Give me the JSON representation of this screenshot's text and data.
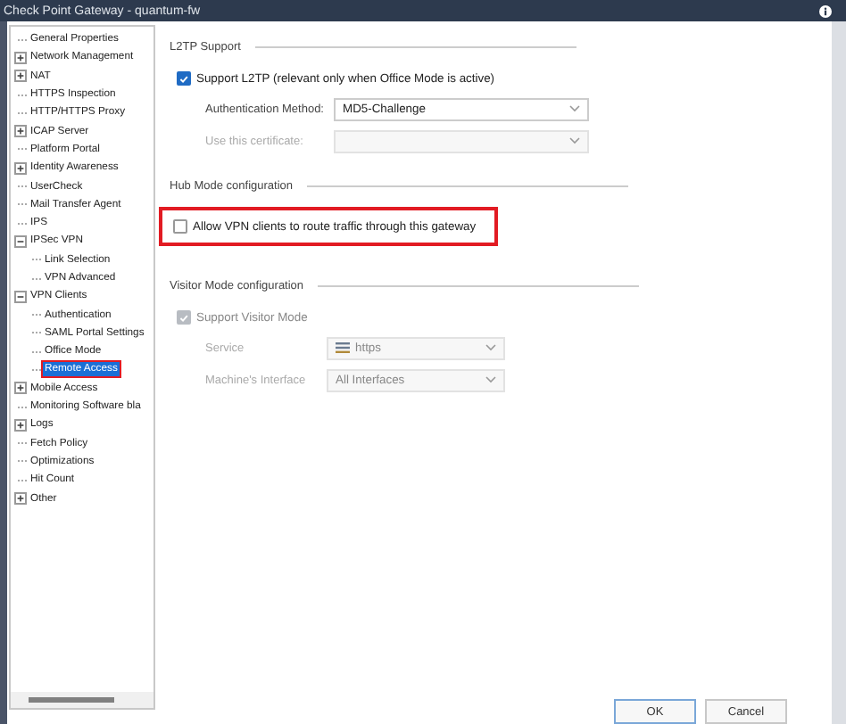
{
  "window": {
    "title": "Check Point Gateway - quantum-fw"
  },
  "tree": [
    {
      "label": "General Properties",
      "selected": false,
      "highlighted": false
    },
    {
      "label": "Network Management",
      "expanded": false,
      "selected": false,
      "highlighted": false
    },
    {
      "label": "NAT",
      "expanded": false,
      "selected": false,
      "highlighted": false
    },
    {
      "label": "HTTPS Inspection",
      "selected": false,
      "highlighted": false
    },
    {
      "label": "HTTP/HTTPS Proxy",
      "selected": false,
      "highlighted": false
    },
    {
      "label": "ICAP Server",
      "expanded": false,
      "selected": false,
      "highlighted": false
    },
    {
      "label": "Platform Portal",
      "selected": false,
      "highlighted": false
    },
    {
      "label": "Identity Awareness",
      "expanded": false,
      "selected": false,
      "highlighted": false
    },
    {
      "label": "UserCheck",
      "selected": false,
      "highlighted": false
    },
    {
      "label": "Mail Transfer Agent",
      "selected": false,
      "highlighted": false
    },
    {
      "label": "IPS",
      "selected": false,
      "highlighted": false
    },
    {
      "label": "IPSec VPN",
      "expanded": true,
      "selected": false,
      "highlighted": false,
      "children": [
        {
          "label": "Link Selection",
          "selected": false,
          "highlighted": false
        },
        {
          "label": "VPN Advanced",
          "selected": false,
          "highlighted": false
        }
      ]
    },
    {
      "label": "VPN Clients",
      "expanded": true,
      "selected": false,
      "highlighted": false,
      "children": [
        {
          "label": "Authentication",
          "selected": false,
          "highlighted": false
        },
        {
          "label": "SAML Portal Settings",
          "selected": false,
          "highlighted": false
        },
        {
          "label": "Office Mode",
          "selected": false,
          "highlighted": false
        },
        {
          "label": "Remote Access",
          "selected": true,
          "highlighted": true
        }
      ]
    },
    {
      "label": "Mobile Access",
      "expanded": false,
      "selected": false,
      "highlighted": false
    },
    {
      "label": "Monitoring Software bla",
      "selected": false,
      "highlighted": false
    },
    {
      "label": "Logs",
      "expanded": false,
      "selected": false,
      "highlighted": false
    },
    {
      "label": "Fetch Policy",
      "selected": false,
      "highlighted": false
    },
    {
      "label": "Optimizations",
      "selected": false,
      "highlighted": false
    },
    {
      "label": "Hit Count",
      "selected": false,
      "highlighted": false
    },
    {
      "label": "Other",
      "expanded": false,
      "selected": false,
      "highlighted": false
    }
  ],
  "sections": [
    {
      "title": "L2TP Support",
      "checkbox": {
        "label": "Support L2TP (relevant only when Office Mode is active)",
        "checked": true,
        "disabled": false,
        "highlighted": false
      },
      "fields": [
        {
          "label": "Authentication Method:",
          "value": "MD5-Challenge",
          "disabled": false
        },
        {
          "label": "Use this certificate:",
          "disabled": true
        }
      ]
    },
    {
      "title": "Hub Mode configuration",
      "checkbox": {
        "label": "Allow VPN clients to route traffic through this gateway",
        "checked": false,
        "disabled": false,
        "highlighted": true
      }
    },
    {
      "title": "Visitor Mode configuration",
      "checkbox": {
        "label": "Support Visitor Mode",
        "checked": true,
        "disabled": true,
        "highlighted": false
      },
      "fields": [
        {
          "label": "Service",
          "value": "https",
          "disabled": true,
          "service_icon": true
        },
        {
          "label": "Machine's Interface",
          "value": "All Interfaces",
          "disabled": true
        }
      ]
    }
  ],
  "buttons": [
    {
      "label": "OK",
      "default": true
    },
    {
      "label": "Cancel",
      "default": false
    }
  ]
}
